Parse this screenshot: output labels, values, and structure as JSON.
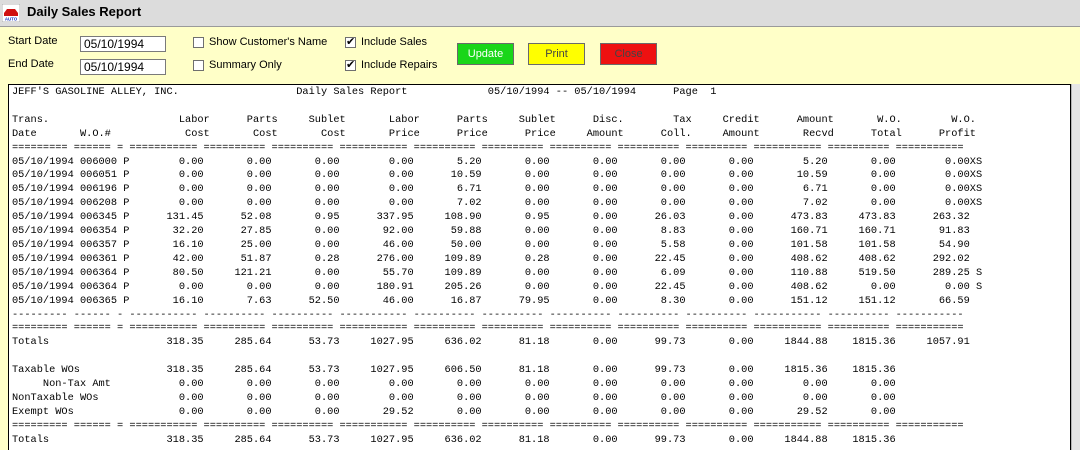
{
  "window": {
    "title": "Daily Sales Report",
    "icon_text": "AUTO"
  },
  "filters": {
    "start_date_label": "Start Date",
    "start_date_value": "05/10/1994",
    "end_date_label": "End Date",
    "end_date_value": "05/10/1994",
    "show_customers_name": {
      "label": "Show Customer's Name",
      "checked": false
    },
    "summary_only": {
      "label": "Summary Only",
      "checked": false
    },
    "include_sales": {
      "label": "Include Sales",
      "checked": true
    },
    "include_repairs": {
      "label": "Include Repairs",
      "checked": true
    }
  },
  "buttons": {
    "update": "Update",
    "print": "Print",
    "close": "Close"
  },
  "colors": {
    "background": "#ffffc8",
    "update": "#19d619",
    "print": "#ffff00",
    "close": "#ee1111"
  },
  "report": {
    "company": "JEFF'S GASOLINE ALLEY, INC.",
    "title": "Daily Sales Report",
    "date_range": "05/10/1994 -- 05/10/1994",
    "page_label": "Page  1",
    "header_line1": [
      "Trans.",
      "",
      "Labor",
      "Parts",
      "Sublet",
      "Labor",
      "Parts",
      "Sublet",
      "Disc.",
      "Tax",
      "Credit",
      "Amount",
      "W.O.",
      "W.O."
    ],
    "header_line2": [
      "Date",
      "W.O.#",
      "Cost",
      "Cost",
      "Cost",
      "Price",
      "Price",
      "Price",
      "Amount",
      "Coll.",
      "Amount",
      "Recvd",
      "Total",
      "Profit"
    ],
    "rows": [
      {
        "date": "05/10/1994",
        "wo": "006000",
        "type": "P",
        "vals": [
          "0.00",
          "0.00",
          "0.00",
          "0.00",
          "5.20",
          "0.00",
          "0.00",
          "0.00",
          "0.00",
          "5.20",
          "0.00",
          "0.00XS"
        ]
      },
      {
        "date": "05/10/1994",
        "wo": "006051",
        "type": "P",
        "vals": [
          "0.00",
          "0.00",
          "0.00",
          "0.00",
          "10.59",
          "0.00",
          "0.00",
          "0.00",
          "0.00",
          "10.59",
          "0.00",
          "0.00XS"
        ]
      },
      {
        "date": "05/10/1994",
        "wo": "006196",
        "type": "P",
        "vals": [
          "0.00",
          "0.00",
          "0.00",
          "0.00",
          "6.71",
          "0.00",
          "0.00",
          "0.00",
          "0.00",
          "6.71",
          "0.00",
          "0.00XS"
        ]
      },
      {
        "date": "05/10/1994",
        "wo": "006208",
        "type": "P",
        "vals": [
          "0.00",
          "0.00",
          "0.00",
          "0.00",
          "7.02",
          "0.00",
          "0.00",
          "0.00",
          "0.00",
          "7.02",
          "0.00",
          "0.00XS"
        ]
      },
      {
        "date": "05/10/1994",
        "wo": "006345",
        "type": "P",
        "vals": [
          "131.45",
          "52.08",
          "0.95",
          "337.95",
          "108.90",
          "0.95",
          "0.00",
          "26.03",
          "0.00",
          "473.83",
          "473.83",
          "263.32"
        ]
      },
      {
        "date": "05/10/1994",
        "wo": "006354",
        "type": "P",
        "vals": [
          "32.20",
          "27.85",
          "0.00",
          "92.00",
          "59.88",
          "0.00",
          "0.00",
          "8.83",
          "0.00",
          "160.71",
          "160.71",
          "91.83"
        ]
      },
      {
        "date": "05/10/1994",
        "wo": "006357",
        "type": "P",
        "vals": [
          "16.10",
          "25.00",
          "0.00",
          "46.00",
          "50.00",
          "0.00",
          "0.00",
          "5.58",
          "0.00",
          "101.58",
          "101.58",
          "54.90"
        ]
      },
      {
        "date": "05/10/1994",
        "wo": "006361",
        "type": "P",
        "vals": [
          "42.00",
          "51.87",
          "0.28",
          "276.00",
          "109.89",
          "0.28",
          "0.00",
          "22.45",
          "0.00",
          "408.62",
          "408.62",
          "292.02"
        ]
      },
      {
        "date": "05/10/1994",
        "wo": "006364",
        "type": "P",
        "vals": [
          "80.50",
          "121.21",
          "0.00",
          "55.70",
          "109.89",
          "0.00",
          "0.00",
          "6.09",
          "0.00",
          "110.88",
          "519.50",
          "289.25 S"
        ]
      },
      {
        "date": "05/10/1994",
        "wo": "006364",
        "type": "P",
        "vals": [
          "0.00",
          "0.00",
          "0.00",
          "180.91",
          "205.26",
          "0.00",
          "0.00",
          "22.45",
          "0.00",
          "408.62",
          "0.00",
          "0.00 S"
        ]
      },
      {
        "date": "05/10/1994",
        "wo": "006365",
        "type": "P",
        "vals": [
          "16.10",
          "7.63",
          "52.50",
          "46.00",
          "16.87",
          "79.95",
          "0.00",
          "8.30",
          "0.00",
          "151.12",
          "151.12",
          "66.59"
        ]
      }
    ],
    "totals": {
      "label": "Totals",
      "vals": [
        "318.35",
        "285.64",
        "53.73",
        "1027.95",
        "636.02",
        "81.18",
        "0.00",
        "99.73",
        "0.00",
        "1844.88",
        "1815.36",
        "1057.91"
      ]
    },
    "summary": [
      {
        "label": "Taxable WOs",
        "vals": [
          "318.35",
          "285.64",
          "53.73",
          "1027.95",
          "606.50",
          "81.18",
          "0.00",
          "99.73",
          "0.00",
          "1815.36",
          "1815.36"
        ]
      },
      {
        "label": "     Non-Tax Amt",
        "vals": [
          "0.00",
          "0.00",
          "0.00",
          "0.00",
          "0.00",
          "0.00",
          "0.00",
          "0.00",
          "0.00",
          "0.00",
          "0.00"
        ]
      },
      {
        "label": "NonTaxable WOs",
        "vals": [
          "0.00",
          "0.00",
          "0.00",
          "0.00",
          "0.00",
          "0.00",
          "0.00",
          "0.00",
          "0.00",
          "0.00",
          "0.00"
        ]
      },
      {
        "label": "Exempt WOs",
        "vals": [
          "0.00",
          "0.00",
          "0.00",
          "29.52",
          "0.00",
          "0.00",
          "0.00",
          "0.00",
          "0.00",
          "29.52",
          "0.00"
        ]
      }
    ],
    "grand_totals": {
      "label": "Totals",
      "vals": [
        "318.35",
        "285.64",
        "53.73",
        "1027.95",
        "636.02",
        "81.18",
        "0.00",
        "99.73",
        "0.00",
        "1844.88",
        "1815.36"
      ]
    }
  }
}
